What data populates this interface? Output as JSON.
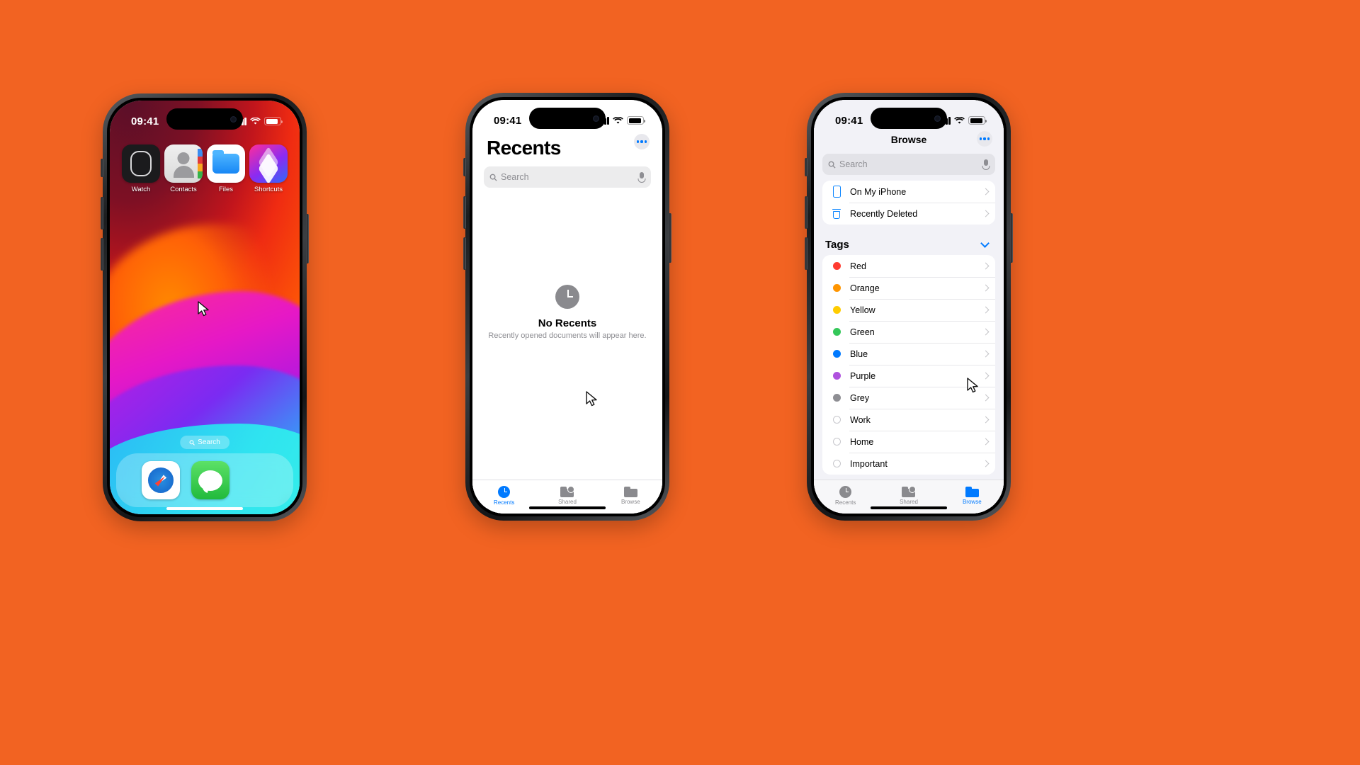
{
  "background_color": "#F26322",
  "phone1": {
    "status": {
      "time": "09:41",
      "signal_icon": "cellular-bars-icon",
      "wifi_icon": "wifi-icon",
      "battery_icon": "battery-icon"
    },
    "apps": [
      {
        "label": "Watch",
        "icon": "watch-app-icon"
      },
      {
        "label": "Contacts",
        "icon": "contacts-app-icon"
      },
      {
        "label": "Files",
        "icon": "files-app-icon"
      },
      {
        "label": "Shortcuts",
        "icon": "shortcuts-app-icon"
      }
    ],
    "search_pill": {
      "label": "Search",
      "icon": "search-icon"
    },
    "dock": [
      {
        "label": "Safari",
        "icon": "safari-app-icon"
      },
      {
        "label": "Messages",
        "icon": "messages-app-icon"
      }
    ]
  },
  "phone2": {
    "status": {
      "time": "09:41",
      "signal_icon": "cellular-bars-icon",
      "wifi_icon": "wifi-icon",
      "battery_icon": "battery-icon"
    },
    "nav": {
      "title": "Recents",
      "more_icon": "more-circle-icon"
    },
    "search": {
      "placeholder": "Search",
      "icon": "search-icon",
      "mic_icon": "microphone-icon"
    },
    "empty": {
      "icon": "clock-icon",
      "title": "No Recents",
      "subtitle": "Recently opened documents will appear here."
    },
    "tabs": [
      {
        "label": "Recents",
        "icon": "clock-icon",
        "active": true
      },
      {
        "label": "Shared",
        "icon": "shared-folder-icon",
        "active": false
      },
      {
        "label": "Browse",
        "icon": "folder-icon",
        "active": false
      }
    ],
    "accent": "#007aff",
    "inactive": "#8a8a8e"
  },
  "phone3": {
    "status": {
      "time": "09:41",
      "signal_icon": "cellular-bars-icon",
      "wifi_icon": "wifi-icon",
      "battery_icon": "battery-icon"
    },
    "nav": {
      "title": "Browse",
      "more_icon": "more-circle-icon"
    },
    "search": {
      "placeholder": "Search",
      "icon": "search-icon",
      "mic_icon": "microphone-icon"
    },
    "locations": [
      {
        "label": "On My iPhone",
        "icon": "iphone-icon"
      },
      {
        "label": "Recently Deleted",
        "icon": "trash-icon"
      }
    ],
    "tags_section": {
      "title": "Tags",
      "collapse_icon": "chevron-down-icon"
    },
    "tags": [
      {
        "label": "Red",
        "color": "#ff3b30",
        "filled": true
      },
      {
        "label": "Orange",
        "color": "#ff9500",
        "filled": true
      },
      {
        "label": "Yellow",
        "color": "#ffcc00",
        "filled": true
      },
      {
        "label": "Green",
        "color": "#34c759",
        "filled": true
      },
      {
        "label": "Blue",
        "color": "#007aff",
        "filled": true
      },
      {
        "label": "Purple",
        "color": "#af52de",
        "filled": true
      },
      {
        "label": "Grey",
        "color": "#8e8e93",
        "filled": true
      },
      {
        "label": "Work",
        "color": "#c7c7cc",
        "filled": false
      },
      {
        "label": "Home",
        "color": "#c7c7cc",
        "filled": false
      },
      {
        "label": "Important",
        "color": "#c7c7cc",
        "filled": false
      }
    ],
    "tabs": [
      {
        "label": "Recents",
        "icon": "clock-icon",
        "active": false
      },
      {
        "label": "Shared",
        "icon": "shared-folder-icon",
        "active": false
      },
      {
        "label": "Browse",
        "icon": "folder-icon",
        "active": true
      }
    ],
    "accent": "#007aff",
    "inactive": "#8a8a8e"
  }
}
